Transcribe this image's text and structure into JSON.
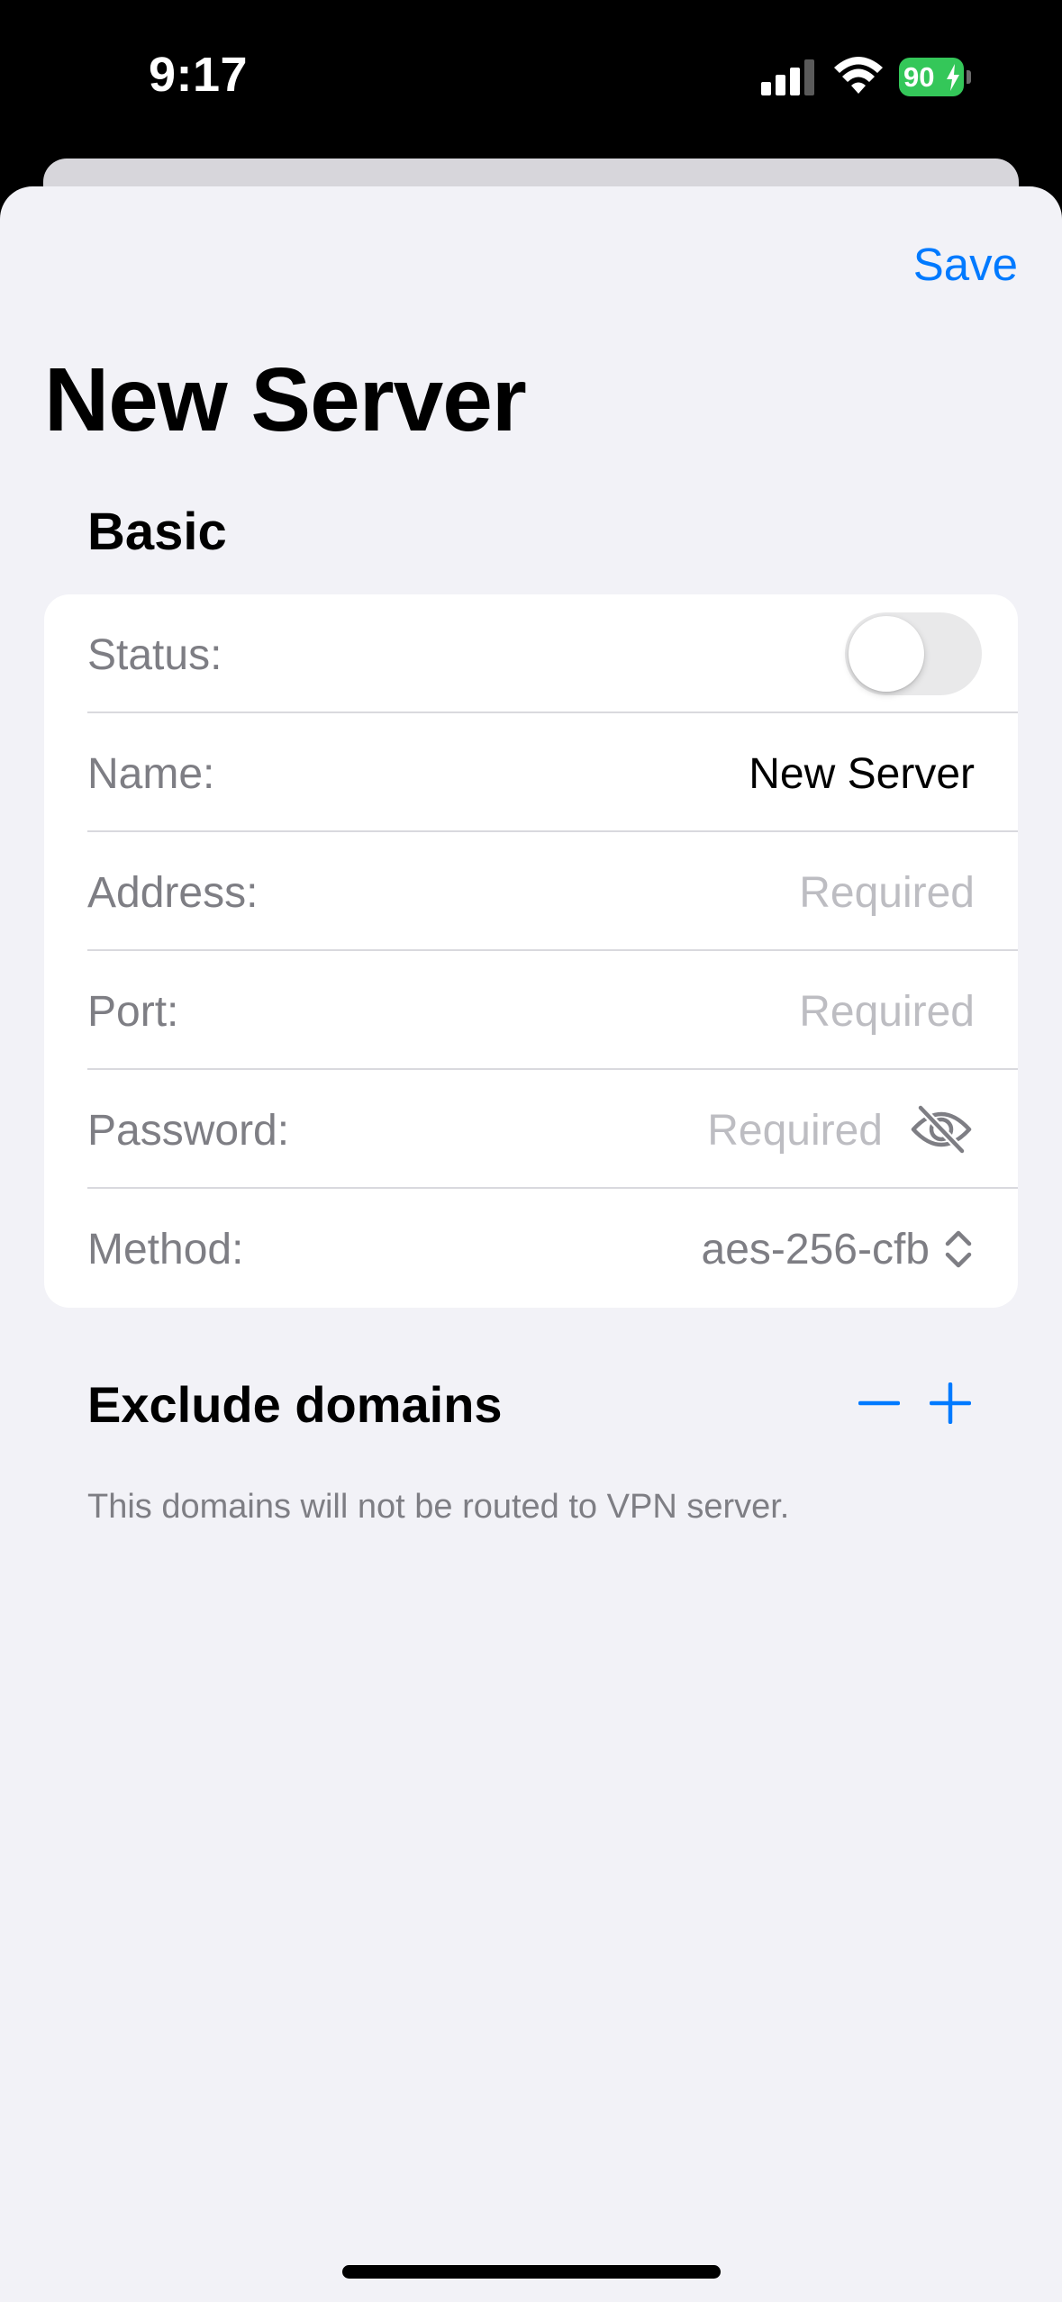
{
  "status_bar": {
    "time": "9:17",
    "battery_level": "90",
    "battery_color": "#34c759",
    "signal_icon": "cellular-signal-icon",
    "wifi_icon": "wifi-icon",
    "battery_icon": "battery-charging-icon"
  },
  "nav": {
    "save_label": "Save",
    "title": "New Server",
    "accent_color": "#007aff"
  },
  "basic_section": {
    "title": "Basic",
    "status": {
      "label": "Status:",
      "enabled": false
    },
    "name": {
      "label": "Name:",
      "value": "New Server"
    },
    "address": {
      "label": "Address:",
      "placeholder": "Required"
    },
    "port": {
      "label": "Port:",
      "placeholder": "Required"
    },
    "password": {
      "label": "Password:",
      "placeholder": "Required",
      "icon": "eye-slash-icon"
    },
    "method": {
      "label": "Method:",
      "value": "aes-256-cfb",
      "icon": "chevron-up-down-icon"
    }
  },
  "exclude_section": {
    "title": "Exclude domains",
    "remove_icon": "minus-icon",
    "add_icon": "plus-icon",
    "hint": "This domains will not be routed to VPN server."
  }
}
